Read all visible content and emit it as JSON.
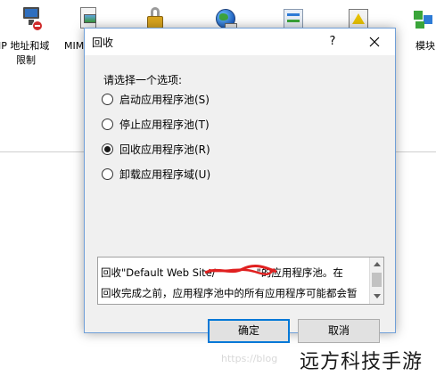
{
  "background": {
    "features": [
      {
        "icon": "ip-restrict-icon",
        "label_line1": "IP 地址和域",
        "label_line2": "限制"
      },
      {
        "icon": "mime-icon",
        "label_line1": "MIM",
        "label_line2": ""
      },
      {
        "icon": "lock-icon",
        "label_line1": "",
        "label_line2": ""
      },
      {
        "icon": "globe-icon",
        "label_line1": "",
        "label_line2": ""
      },
      {
        "icon": "redirect-icon",
        "label_line1": "",
        "label_line2": ""
      },
      {
        "icon": "error-pages-icon",
        "label_line1": "",
        "label_line2": ""
      },
      {
        "icon": "modules-icon",
        "label_line1": "模块",
        "label_line2": ""
      }
    ]
  },
  "dialog": {
    "title": "回收",
    "help_label": "?",
    "prompt": "请选择一个选项:",
    "options": [
      {
        "label": "启动应用程序池(S)",
        "checked": false
      },
      {
        "label": "停止应用程序池(T)",
        "checked": false
      },
      {
        "label": "回收应用程序池(R)",
        "checked": true
      },
      {
        "label": "卸载应用程序域(U)",
        "checked": false
      }
    ],
    "description_line1": "回收\"Default Web Site/    \"的应用程序池。在",
    "description_line2": "回收完成之前，应用程序池中的所有应用程序可能都会暂",
    "ok_label": "确定",
    "cancel_label": "取消"
  },
  "watermark": {
    "text": "远方科技手游",
    "url": "https://blog"
  }
}
